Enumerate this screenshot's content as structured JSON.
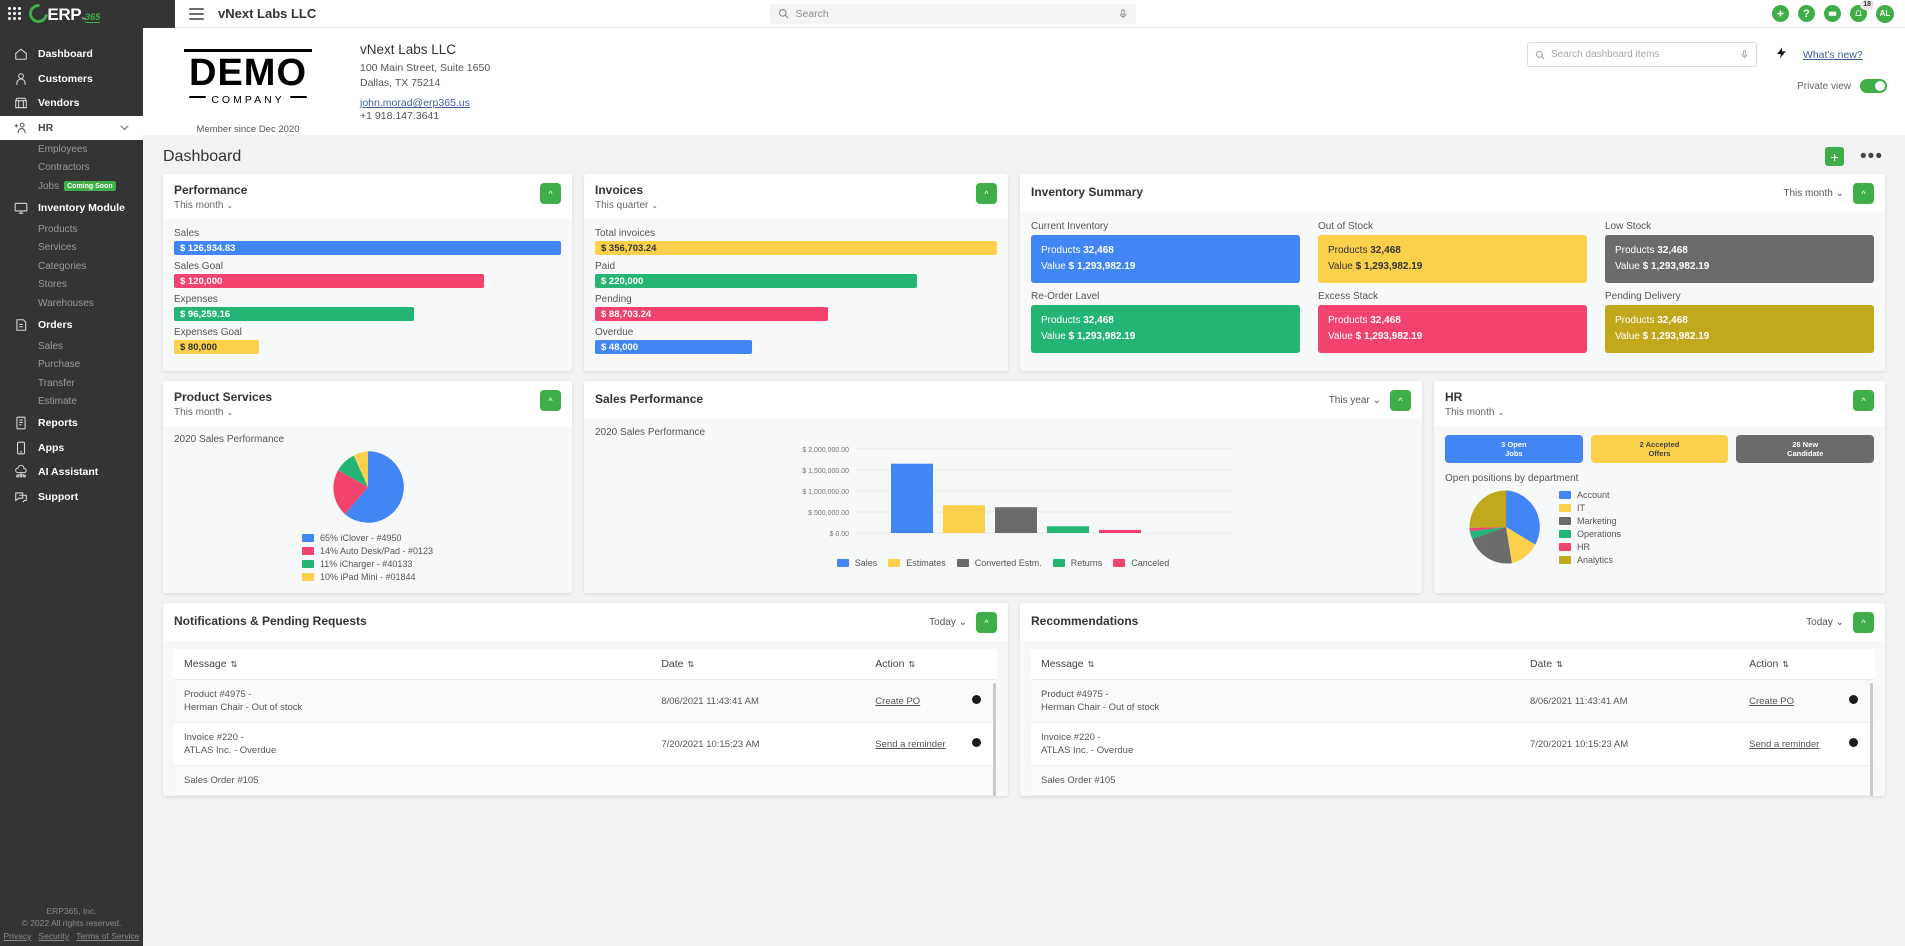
{
  "topbar": {
    "brand": {
      "erp": "ERP",
      "tm": "™",
      "suffix": "365"
    },
    "title": "vNext Labs LLC",
    "search_placeholder": "Search",
    "search_value": "",
    "notification_count": "18",
    "avatar_initials": "AL",
    "icons": {
      "add": "+",
      "help": "?",
      "chat": "⌨",
      "bell": "⌂"
    }
  },
  "sidebar": {
    "items": [
      {
        "label": "Dashboard",
        "icon": "home-icon",
        "active": false
      },
      {
        "label": "Customers",
        "icon": "user-icon",
        "active": false
      },
      {
        "label": "Vendors",
        "icon": "store-icon",
        "active": false
      },
      {
        "label": "HR",
        "icon": "hr-icon",
        "active": true,
        "expandable": true
      }
    ],
    "hr_subitems": [
      {
        "label": "Employees"
      },
      {
        "label": "Contractors"
      },
      {
        "label": "Jobs",
        "tag": "Coming Soon"
      }
    ],
    "inventory": {
      "label": "Inventory Module",
      "icon": "monitor-icon"
    },
    "inventory_subitems": [
      {
        "label": "Products"
      },
      {
        "label": "Services"
      },
      {
        "label": "Categories"
      },
      {
        "label": "Stores"
      },
      {
        "label": "Warehouses"
      }
    ],
    "orders": {
      "label": "Orders",
      "icon": "orders-icon"
    },
    "orders_subitems": [
      {
        "label": "Sales"
      },
      {
        "label": "Purchase"
      },
      {
        "label": "Transfer"
      },
      {
        "label": "Estimate"
      }
    ],
    "bottom_items": [
      {
        "label": "Reports",
        "icon": "report-icon"
      },
      {
        "label": "Apps",
        "icon": "apps-icon"
      },
      {
        "label": "AI Assistant",
        "icon": "cloud-ai-icon"
      },
      {
        "label": "Support",
        "icon": "support-icon"
      }
    ],
    "footer": {
      "company": "ERP365, Inc.",
      "copyright": "© 2022 All rights reserved.",
      "links": [
        "Privacy",
        "Security",
        "Terms of Service"
      ]
    }
  },
  "company": {
    "logo_word": "DEMO",
    "logo_sub": "COMPANY",
    "member_since": "Member since Dec 2020",
    "name": "vNext Labs LLC",
    "address1": "100 Main Street, Suite 1650",
    "address2": "Dallas, TX 75214",
    "email": "john.morad@erp365.us",
    "phone": "+1 918.147.3641"
  },
  "tools": {
    "dashboard_search_placeholder": "Search dashboard items",
    "dashboard_search_value": "",
    "whats_new": "What's new?",
    "private_view_label": "Private view"
  },
  "page": {
    "title": "Dashboard"
  },
  "performance": {
    "title": "Performance",
    "period": "This month",
    "chart_data": {
      "type": "bar",
      "title": "Performance",
      "categories": [
        "Sales",
        "Sales Goal",
        "Expenses",
        "Expenses Goal"
      ],
      "value_labels": [
        "$ 126,934.83",
        "$ 120,000",
        "$ 96,259.16",
        "$ 80,000"
      ],
      "values": [
        126934.83,
        120000,
        96259.16,
        80000
      ],
      "colors": [
        "#4285f4",
        "#f2426e",
        "#24b473",
        "#fbd14b"
      ],
      "widths_pct": [
        100,
        80,
        62,
        22
      ]
    }
  },
  "invoices": {
    "title": "Invoices",
    "period": "This quarter",
    "chart_data": {
      "type": "bar",
      "title": "Invoices",
      "categories": [
        "Total invoices",
        "Paid",
        "Pending",
        "Overdue"
      ],
      "value_labels": [
        "$ 356,703.24",
        "$ 220,000",
        "$ 88,703.24",
        "$ 48,000"
      ],
      "values": [
        356703.24,
        220000,
        88703.24,
        48000
      ],
      "colors": [
        "#fbd14b",
        "#24b473",
        "#f2426e",
        "#4285f4"
      ],
      "widths_pct": [
        100,
        80,
        58,
        39
      ]
    }
  },
  "inventory_summary": {
    "title": "Inventory Summary",
    "period": "This month",
    "tiles": [
      {
        "label": "Current Inventory",
        "products_label": "Products",
        "products": "32,468",
        "value_label": "Value",
        "value": "$ 1,293,982.19",
        "color": "#4285f4",
        "text": "#ffffff"
      },
      {
        "label": "Out of Stock",
        "products_label": "Products",
        "products": "32,468",
        "value_label": "Value",
        "value": "$ 1,293,982.19",
        "color": "#fbd14b",
        "text": "#333333"
      },
      {
        "label": "Low Stock",
        "products_label": "Products",
        "products": "32,468",
        "value_label": "Value",
        "value": "$ 1,293,982.19",
        "color": "#6b6b6b",
        "text": "#ffffff"
      },
      {
        "label": "Re-Order Lavel",
        "products_label": "Products",
        "products": "32,468",
        "value_label": "Value",
        "value": "$ 1,293,982.19",
        "color": "#24b473",
        "text": "#ffffff"
      },
      {
        "label": "Excess Stack",
        "products_label": "Products",
        "products": "32,468",
        "value_label": "Value",
        "value": "$ 1,293,982.19",
        "color": "#f2426e",
        "text": "#ffffff"
      },
      {
        "label": "Pending Delivery",
        "products_label": "Products",
        "products": "32,468",
        "value_label": "Value",
        "value": "$ 1,293,982.19",
        "color": "#c1a71b",
        "text": "#ffffff"
      }
    ]
  },
  "product_services": {
    "title": "Product Services",
    "period": "This month",
    "chart_data": {
      "type": "pie",
      "title": "2020 Sales Performance",
      "categories": [
        "iClover - #4950",
        "Auto Desk/Pad - #0123",
        "iCharger - #40133",
        "iPad Mini - #01844"
      ],
      "values": [
        65,
        14,
        11,
        10
      ],
      "legend_labels": [
        "65% iClover - #4950",
        "14% Auto Desk/Pad - #0123",
        "11% iCharger - #40133",
        "10% iPad Mini - #01844"
      ],
      "colors": [
        "#4285f4",
        "#f2426e",
        "#24b473",
        "#fbd14b"
      ],
      "legend_position": "bottom"
    }
  },
  "sales_performance": {
    "title": "Sales Performance",
    "period": "This year",
    "chart_data": {
      "type": "bar",
      "title": "2020 Sales Performance",
      "categories": [
        "Sales",
        "Estimates",
        "Converted Estm.",
        "Returns",
        "Canceled"
      ],
      "values": [
        1650000,
        660000,
        615000,
        160000,
        75000
      ],
      "colors": [
        "#4285f4",
        "#fbd14b",
        "#6b6b6b",
        "#24b473",
        "#f2426e"
      ],
      "ylabel": "",
      "xlabel": "",
      "ylim": [
        0,
        2000000
      ],
      "ytick_labels": [
        "$ 2,000,000.00",
        "$ 1,500,000.00",
        "$ 1,000,000.00",
        "$ 500,000.00",
        "$ 0.00"
      ],
      "ytick_values": [
        2000000,
        1500000,
        1000000,
        500000,
        0
      ],
      "legend_labels": [
        "Sales",
        "Estimates",
        "Converted Estm.",
        "Returns",
        "Canceled"
      ],
      "legend_position": "bottom",
      "grid": true
    }
  },
  "hr": {
    "title": "HR",
    "period": "This month",
    "pills": [
      {
        "line1": "3 Open",
        "line2": "Jobs",
        "color": "#4285f4"
      },
      {
        "line1": "2 Accepted",
        "line2": "Offers",
        "color": "#fbd14b"
      },
      {
        "line1": "26 New",
        "line2": "Candidate",
        "color": "#6b6b6b"
      }
    ],
    "subtitle": "Open positions by department",
    "chart_data": {
      "type": "pie",
      "title": "Open positions by department",
      "categories": [
        "Account",
        "IT",
        "Marketing",
        "Operations",
        "HR",
        "Analytics"
      ],
      "values": [
        22,
        17,
        26,
        6,
        2,
        27
      ],
      "colors": [
        "#4285f4",
        "#fbd14b",
        "#6b6b6b",
        "#24b473",
        "#f2426e",
        "#c1a71b"
      ],
      "legend_position": "right"
    }
  },
  "notifications": {
    "title": "Notifications & Pending Requests",
    "period": "Today",
    "columns": [
      "Message",
      "Date",
      "Action"
    ],
    "rows": [
      {
        "message_line1": "Product #4975 -",
        "message_line2": "Herman Chair - Out of stock",
        "date": "8/06/2021 11:43:41 AM",
        "action": "Create PO"
      },
      {
        "message_line1": "Invoice #220 -",
        "message_line2": "ATLAS Inc. - Overdue",
        "date": "7/20/2021 10:15:23 AM",
        "action": "Send a reminder"
      },
      {
        "message_line1": "Sales Order #105",
        "message_line2": "",
        "date": "",
        "action": ""
      }
    ]
  },
  "recommendations": {
    "title": "Recommendations",
    "period": "Today",
    "columns": [
      "Message",
      "Date",
      "Action"
    ],
    "rows": [
      {
        "message_line1": "Product #4975 -",
        "message_line2": "Herman Chair - Out of stock",
        "date": "8/06/2021 11:43:41 AM",
        "action": "Create PO"
      },
      {
        "message_line1": "Invoice #220 -",
        "message_line2": "ATLAS Inc. - Overdue",
        "date": "7/20/2021 10:15:23 AM",
        "action": "Send a reminder"
      },
      {
        "message_line1": "Sales Order #105",
        "message_line2": "",
        "date": "",
        "action": ""
      }
    ]
  }
}
